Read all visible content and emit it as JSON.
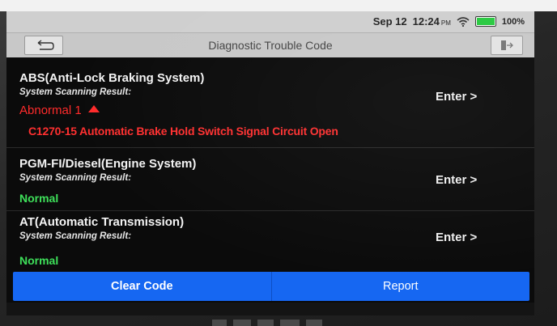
{
  "status_bar": {
    "date": "Sep 12",
    "time": "12:24",
    "ampm": "PM",
    "battery": "100%"
  },
  "header": {
    "title": "Diagnostic Trouble Code",
    "back_icon": "back-arrow-icon",
    "exit_icon": "exit-icon"
  },
  "systems": [
    {
      "name": "ABS(Anti-Lock Braking System)",
      "scan_label": "System Scanning Result:",
      "status": "Abnormal 1",
      "enter_label": "Enter >",
      "dtc": "C1270-15 Automatic Brake Hold Switch Signal Circuit Open"
    },
    {
      "name": "PGM-FI/Diesel(Engine System)",
      "scan_label": "System Scanning Result:",
      "status": "Normal",
      "enter_label": "Enter >"
    },
    {
      "name": "AT(Automatic Transmission)",
      "scan_label": "System Scanning Result:",
      "status": "Normal",
      "enter_label": "Enter >"
    }
  ],
  "actions": {
    "clear_code": "Clear Code",
    "report": "Report"
  },
  "colors": {
    "abnormal": "#ff2b2b",
    "normal": "#3ee05a",
    "action_bar": "#1667f2"
  }
}
